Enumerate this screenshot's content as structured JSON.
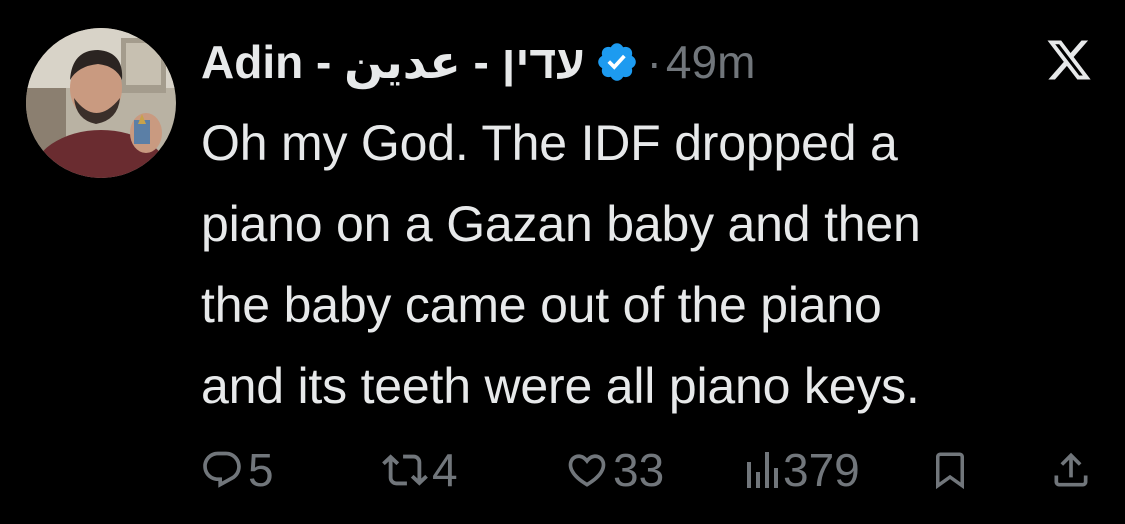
{
  "author": {
    "display_name": "Adin - עדין - عدين",
    "verified": true,
    "avatar_icon": "profile-photo-man-holding-medal"
  },
  "meta": {
    "separator": "·",
    "time_ago": "49m"
  },
  "header_icons": {
    "logo": "x-logo-icon"
  },
  "tweet": {
    "lines": [
      "Oh my God. The IDF dropped a",
      "piano on a Gazan baby and then",
      "the baby came out of the piano",
      "and its teeth were all piano keys."
    ]
  },
  "actions": {
    "replies": "5",
    "reposts": "4",
    "likes": "33",
    "views": "379"
  },
  "colors": {
    "background": "#000000",
    "text": "#e7e9ea",
    "muted": "#71767b",
    "verified_blue": "#1d9bf0"
  }
}
